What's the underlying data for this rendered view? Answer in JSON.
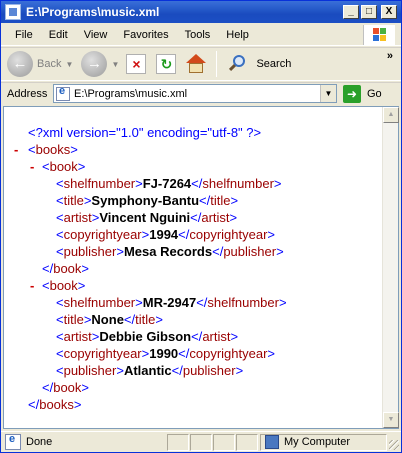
{
  "window": {
    "title": "E:\\Programs\\music.xml"
  },
  "titlebar_buttons": {
    "minimize": "_",
    "maximize": "□",
    "close": "X"
  },
  "menu": [
    "File",
    "Edit",
    "View",
    "Favorites",
    "Tools",
    "Help"
  ],
  "toolbar": {
    "back_label": "Back",
    "search_label": "Search",
    "more": "»"
  },
  "address": {
    "label": "Address",
    "value": "E:\\Programs\\music.xml",
    "go_label": "Go"
  },
  "xml": {
    "declaration": "<?xml version=\"1.0\" encoding=\"utf-8\" ?>",
    "root_tag": "books",
    "book_tag": "book",
    "books": [
      {
        "fields": [
          {
            "tag": "shelfnumber",
            "value": "FJ-7264"
          },
          {
            "tag": "title",
            "value": "Symphony-Bantu"
          },
          {
            "tag": "artist",
            "value": "Vincent Nguini"
          },
          {
            "tag": "copyrightyear",
            "value": "1994"
          },
          {
            "tag": "publisher",
            "value": "Mesa Records"
          }
        ]
      },
      {
        "fields": [
          {
            "tag": "shelfnumber",
            "value": "MR-2947"
          },
          {
            "tag": "title",
            "value": "None"
          },
          {
            "tag": "artist",
            "value": "Debbie Gibson"
          },
          {
            "tag": "copyrightyear",
            "value": "1990"
          },
          {
            "tag": "publisher",
            "value": "Atlantic"
          }
        ]
      }
    ]
  },
  "status": {
    "text": "Done",
    "zone": "My Computer"
  },
  "colors": {
    "tag": "#990000",
    "bracket": "#0000ff",
    "minus": "#cc0000",
    "titlebar": "#2458c8"
  }
}
